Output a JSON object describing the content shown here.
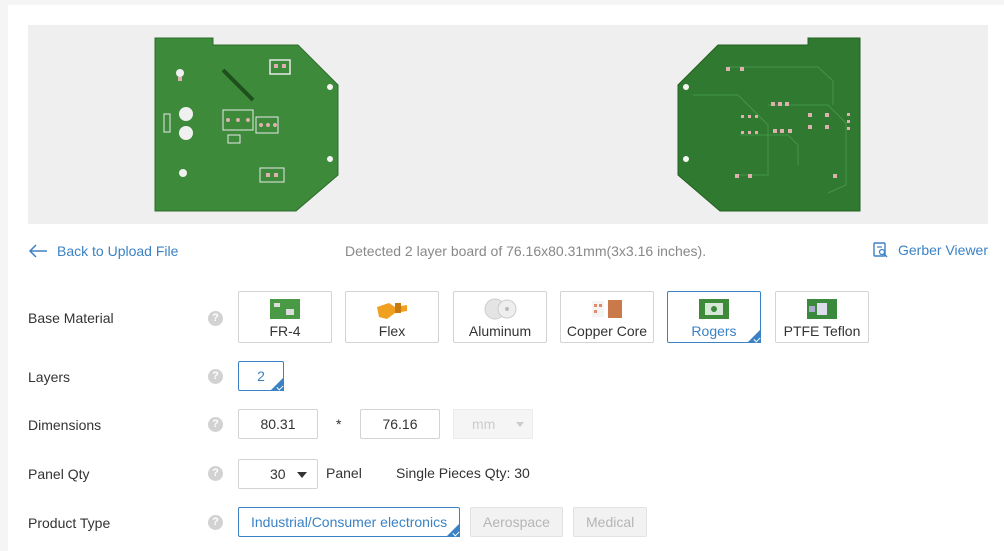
{
  "nav": {
    "back_label": "Back to Upload File",
    "detected_text": "Detected 2 layer board of 76.16x80.31mm(3x3.16 inches).",
    "gerber_label": "Gerber Viewer"
  },
  "base_material": {
    "label": "Base Material",
    "help": "?",
    "options": [
      "FR-4",
      "Flex",
      "Aluminum",
      "Copper Core",
      "Rogers",
      "PTFE Teflon"
    ],
    "selected": "Rogers"
  },
  "layers": {
    "label": "Layers",
    "help": "?",
    "value": "2"
  },
  "dimensions": {
    "label": "Dimensions",
    "help": "?",
    "width": "80.31",
    "separator": "*",
    "height": "76.16",
    "unit": "mm"
  },
  "panel_qty": {
    "label": "Panel Qty",
    "help": "?",
    "value": "30",
    "unit_label": "Panel",
    "single_pieces": "Single Pieces Qty: 30"
  },
  "product_type": {
    "label": "Product Type",
    "help": "?",
    "options": [
      "Industrial/Consumer electronics",
      "Aerospace",
      "Medical"
    ],
    "selected": "Industrial/Consumer electronics"
  },
  "colors": {
    "accent": "#3b82c4",
    "pcb_top": "#3c8a3a",
    "pcb_bottom": "#2f7a30"
  }
}
